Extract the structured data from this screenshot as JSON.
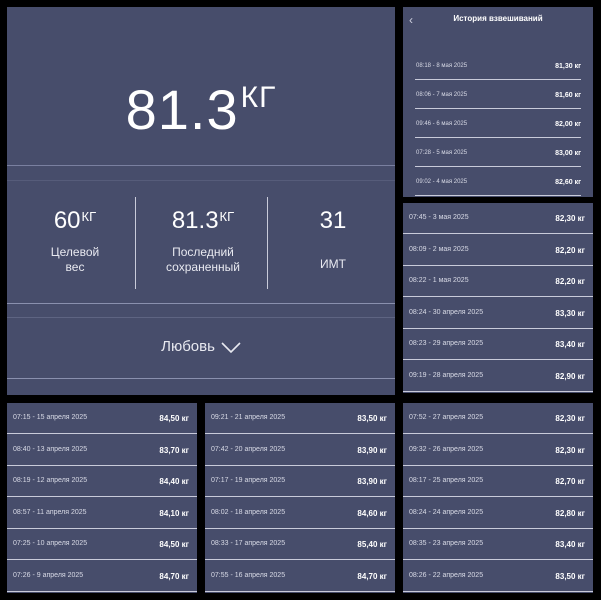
{
  "main": {
    "current_value": "81.3",
    "current_unit": "КГ",
    "target": {
      "value": "60",
      "unit": "КГ",
      "label_line1": "Целевой",
      "label_line2": "вес"
    },
    "last_saved": {
      "value": "81.3",
      "unit": "КГ",
      "label_line1": "Последний",
      "label_line2": "сохраненный"
    },
    "bmi": {
      "value": "31",
      "label": "ИМТ"
    },
    "profile_name": "Любовь"
  },
  "history": {
    "title": "История взвешиваний",
    "back_icon": "chevron-left-icon",
    "entries": [
      {
        "date": "08:18 - 8 мая 2025",
        "weight": "81,30 кг"
      },
      {
        "date": "08:06 - 7 мая 2025",
        "weight": "81,60 кг"
      },
      {
        "date": "09:46 - 6 мая 2025",
        "weight": "82,00 кг"
      },
      {
        "date": "07:28 - 5 мая 2025",
        "weight": "83,00 кг"
      },
      {
        "date": "09:02 - 4 мая 2025",
        "weight": "82,60 кг"
      }
    ]
  },
  "list1": [
    {
      "date": "07:45 - 3 мая 2025",
      "weight": "82,30 кг"
    },
    {
      "date": "08:09 - 2 мая 2025",
      "weight": "82,20 кг"
    },
    {
      "date": "08:22 - 1 мая 2025",
      "weight": "82,20 кг"
    },
    {
      "date": "08:24 - 30 апреля 2025",
      "weight": "83,30 кг"
    },
    {
      "date": "08:23 - 29 апреля 2025",
      "weight": "83,40 кг"
    },
    {
      "date": "09:19 - 28 апреля 2025",
      "weight": "82,90 кг"
    }
  ],
  "list2": [
    {
      "date": "07:15 - 15 апреля 2025",
      "weight": "84,50 кг"
    },
    {
      "date": "08:40 - 13 апреля 2025",
      "weight": "83,70 кг"
    },
    {
      "date": "08:19 - 12 апреля 2025",
      "weight": "84,40 кг"
    },
    {
      "date": "08:57 - 11 апреля 2025",
      "weight": "84,10 кг"
    },
    {
      "date": "07:25 - 10 апреля 2025",
      "weight": "84,50 кг"
    },
    {
      "date": "07:26 - 9 апреля 2025",
      "weight": "84,70 кг"
    }
  ],
  "list3": [
    {
      "date": "09:21 - 21 апреля 2025",
      "weight": "83,50 кг"
    },
    {
      "date": "07:42 - 20 апреля 2025",
      "weight": "83,90 кг"
    },
    {
      "date": "07:17 - 19 апреля 2025",
      "weight": "83,90 кг"
    },
    {
      "date": "08:02 - 18 апреля 2025",
      "weight": "84,60 кг"
    },
    {
      "date": "08:33 - 17 апреля 2025",
      "weight": "85,40 кг"
    },
    {
      "date": "07:55 - 16 апреля 2025",
      "weight": "84,70 кг"
    }
  ],
  "list4": [
    {
      "date": "07:52 - 27 апреля 2025",
      "weight": "82,30 кг"
    },
    {
      "date": "09:32 - 26 апреля 2025",
      "weight": "82,30 кг"
    },
    {
      "date": "08:17 - 25 апреля 2025",
      "weight": "82,70 кг"
    },
    {
      "date": "08:24 - 24 апреля 2025",
      "weight": "82,80 кг"
    },
    {
      "date": "08:35 - 23 апреля 2025",
      "weight": "83,40 кг"
    },
    {
      "date": "08:26 - 22 апреля 2025",
      "weight": "83,50 кг"
    }
  ]
}
